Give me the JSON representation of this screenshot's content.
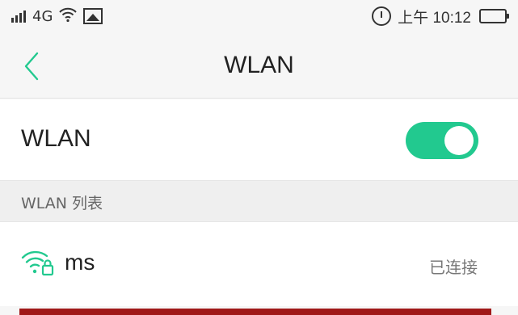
{
  "status_bar": {
    "network_type": "4G",
    "time": "上午 10:12"
  },
  "header": {
    "title": "WLAN"
  },
  "wlan_toggle": {
    "label": "WLAN",
    "enabled": true,
    "accent_color": "#22c98f"
  },
  "section": {
    "label": "WLAN 列表"
  },
  "networks": [
    {
      "name": "ms",
      "status": "已连接",
      "secured": true
    }
  ],
  "colors": {
    "accent": "#22c98f",
    "bottom_bar": "#a01818"
  }
}
